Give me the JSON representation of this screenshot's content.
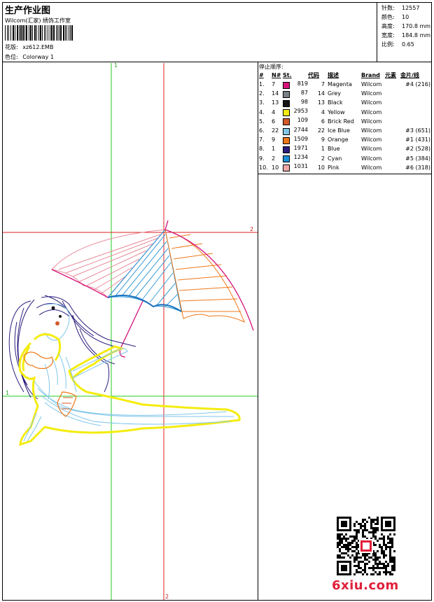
{
  "header": {
    "title": "生产作业图",
    "company": "Wilcom(汇家) 绣饰工作室",
    "design_label": "花版:",
    "design_value": "xz612.EMB",
    "colorway_label": "色位:",
    "colorway_value": "Colorway 1"
  },
  "stats": [
    {
      "label": "针数:",
      "value": "12557"
    },
    {
      "label": "颜色:",
      "value": "10"
    },
    {
      "label": "高度:",
      "value": "170.8 mm"
    },
    {
      "label": "宽度:",
      "value": "184.8 mm"
    },
    {
      "label": "比例:",
      "value": "0.65"
    }
  ],
  "sequence": {
    "title": "停止顺序:",
    "headers": [
      "#",
      "N#",
      "St.",
      "代码",
      "描述",
      "Brand",
      "元素",
      "金片/线"
    ],
    "rows": [
      {
        "idx": "1.",
        "n": "7",
        "color": "#d6147a",
        "st": "819",
        "code": "7",
        "desc": "Magenta",
        "brand": "Wilcom",
        "extra": "#4 (216)"
      },
      {
        "idx": "2.",
        "n": "14",
        "color": "#7a7f88",
        "st": "87",
        "code": "14",
        "desc": "Grey",
        "brand": "Wilcom",
        "extra": ""
      },
      {
        "idx": "3.",
        "n": "13",
        "color": "#151515",
        "st": "98",
        "code": "13",
        "desc": "Black",
        "brand": "Wilcom",
        "extra": ""
      },
      {
        "idx": "4.",
        "n": "4",
        "color": "#f4ec10",
        "st": "2953",
        "code": "4",
        "desc": "Yellow",
        "brand": "Wilcom",
        "extra": ""
      },
      {
        "idx": "5.",
        "n": "6",
        "color": "#d25a2a",
        "st": "109",
        "code": "6",
        "desc": "Brick Red",
        "brand": "Wilcom",
        "extra": ""
      },
      {
        "idx": "6.",
        "n": "22",
        "color": "#7fc6ea",
        "st": "2744",
        "code": "22",
        "desc": "Ice Blue",
        "brand": "Wilcom",
        "extra": "#3 (651)"
      },
      {
        "idx": "7.",
        "n": "9",
        "color": "#f07818",
        "st": "1509",
        "code": "9",
        "desc": "Orange",
        "brand": "Wilcom",
        "extra": "#1 (431)"
      },
      {
        "idx": "8.",
        "n": "1",
        "color": "#2a1c7c",
        "st": "1971",
        "code": "1",
        "desc": "Blue",
        "brand": "Wilcom",
        "extra": "#2 (528)"
      },
      {
        "idx": "9.",
        "n": "2",
        "color": "#1a8fd6",
        "st": "1234",
        "code": "2",
        "desc": "Cyan",
        "brand": "Wilcom",
        "extra": "#5 (384)"
      },
      {
        "idx": "10.",
        "n": "10",
        "color": "#f0a8a8",
        "st": "1031",
        "code": "10",
        "desc": "Pink",
        "brand": "Wilcom",
        "extra": "#6 (318)"
      }
    ]
  },
  "guides": {
    "v1_label": "1",
    "v2_label": "2",
    "h1_label": "1",
    "h2_label": "2",
    "v1_color": "#22cc22",
    "v2_color": "#e02020"
  },
  "watermark": {
    "text": "6xiu.com",
    "color": "#e0203a"
  }
}
